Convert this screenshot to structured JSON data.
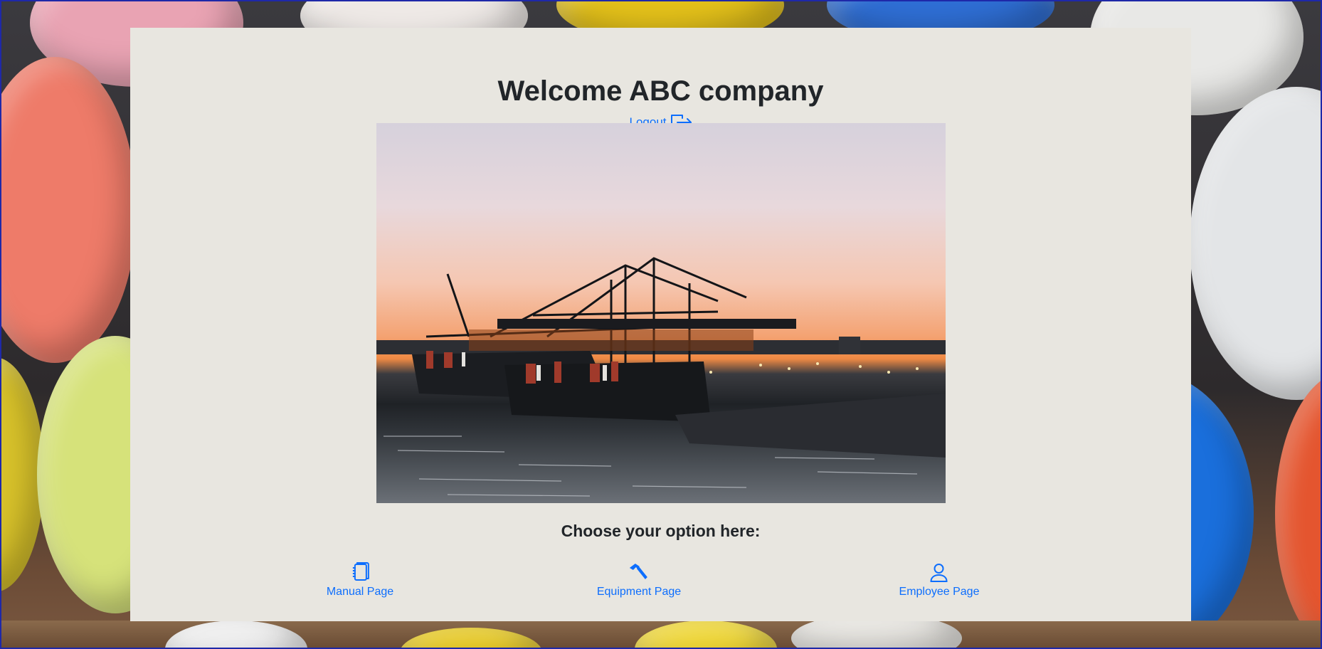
{
  "header": {
    "title": "Welcome ABC company",
    "logout_label": "Logout"
  },
  "main": {
    "choose_label": "Choose your option here:",
    "options": [
      {
        "label": "Manual Page",
        "icon": "journals-icon"
      },
      {
        "label": "Equipment Page",
        "icon": "hammer-icon"
      },
      {
        "label": "Employee Page",
        "icon": "person-icon"
      }
    ]
  },
  "colors": {
    "accent": "#0d6efd",
    "card_background": "#e8e6e0",
    "text": "#212529"
  }
}
